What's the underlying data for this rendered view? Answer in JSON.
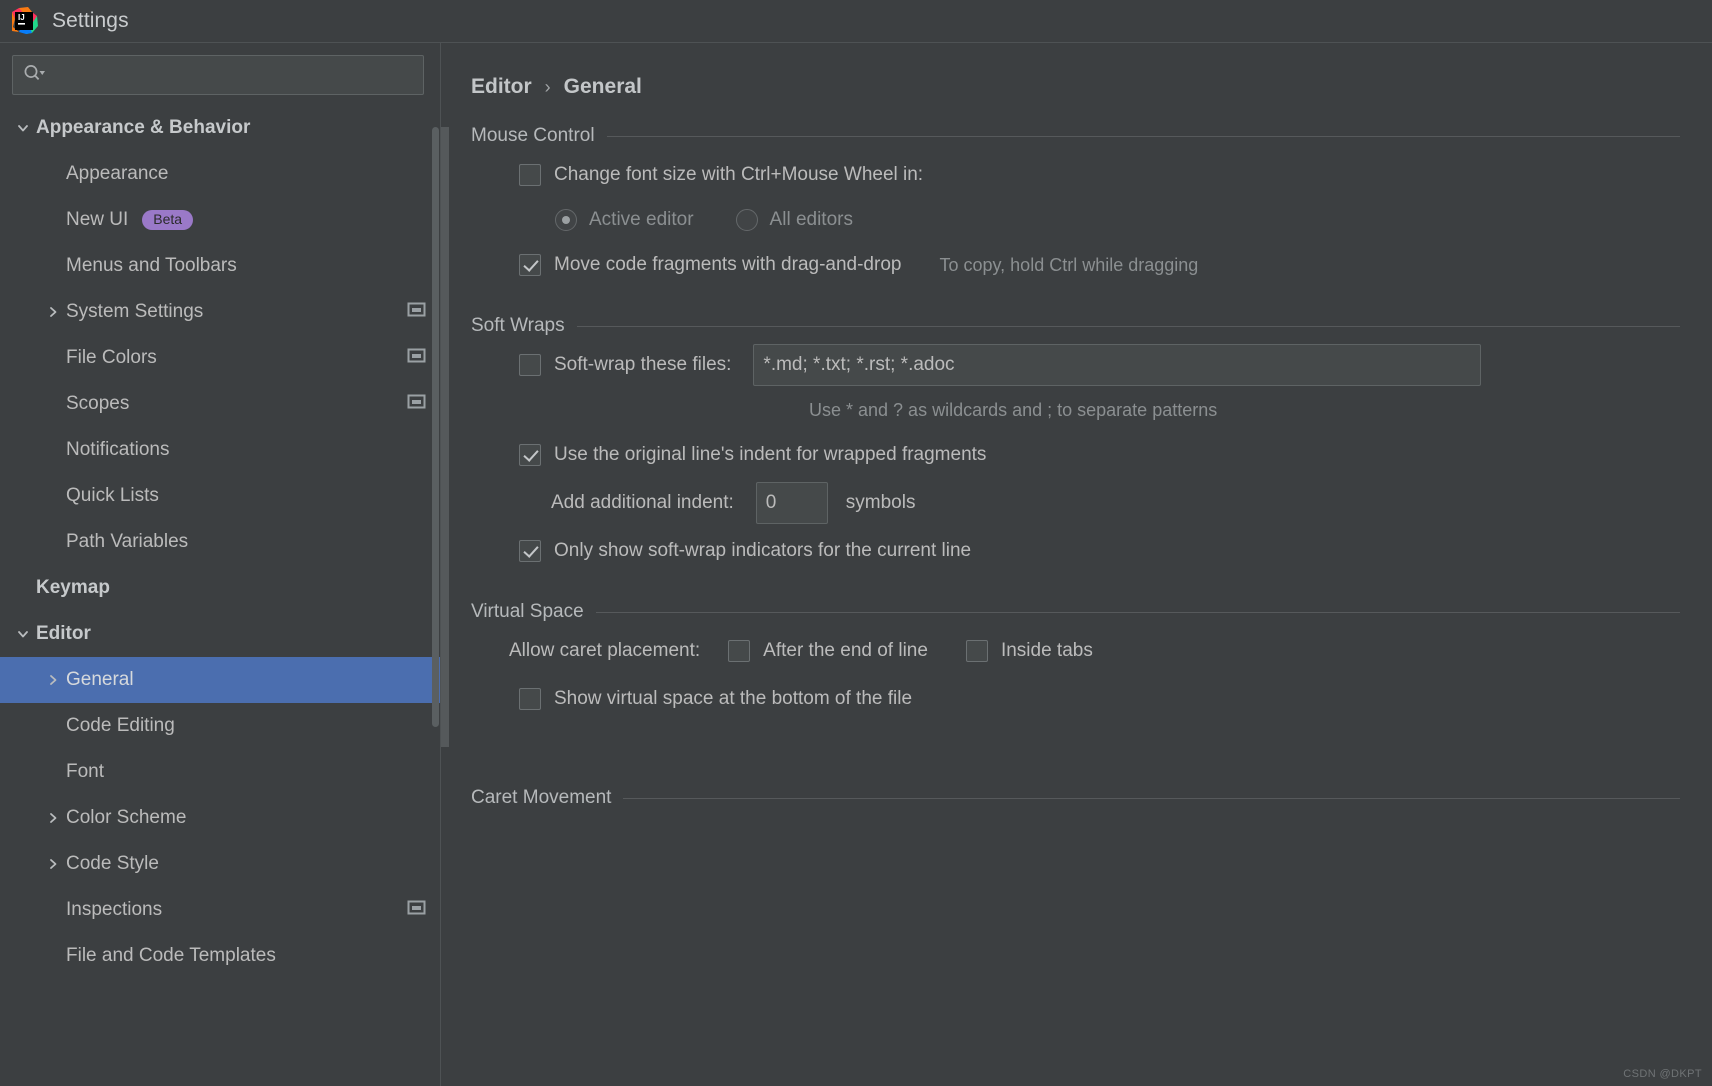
{
  "window": {
    "title": "Settings",
    "logo_icon": "intellij-idea-logo"
  },
  "search": {
    "value": "",
    "placeholder": "",
    "icon": "search-icon"
  },
  "sidebar": {
    "items": [
      {
        "label": "Appearance & Behavior",
        "level": 0,
        "bold": true,
        "twisty": "chevron-down",
        "selected": false,
        "badge": "",
        "trailing_icon": ""
      },
      {
        "label": "Appearance",
        "level": 1,
        "bold": false,
        "twisty": "",
        "selected": false,
        "badge": "",
        "trailing_icon": ""
      },
      {
        "label": "New UI",
        "level": 1,
        "bold": false,
        "twisty": "",
        "selected": false,
        "badge": "Beta",
        "trailing_icon": ""
      },
      {
        "label": "Menus and Toolbars",
        "level": 1,
        "bold": false,
        "twisty": "",
        "selected": false,
        "badge": "",
        "trailing_icon": ""
      },
      {
        "label": "System Settings",
        "level": 1,
        "bold": false,
        "twisty": "chevron-right",
        "selected": false,
        "badge": "",
        "trailing_icon": "project-scope-icon"
      },
      {
        "label": "File Colors",
        "level": 1,
        "bold": false,
        "twisty": "",
        "selected": false,
        "badge": "",
        "trailing_icon": "project-scope-icon"
      },
      {
        "label": "Scopes",
        "level": 1,
        "bold": false,
        "twisty": "",
        "selected": false,
        "badge": "",
        "trailing_icon": "project-scope-icon"
      },
      {
        "label": "Notifications",
        "level": 1,
        "bold": false,
        "twisty": "",
        "selected": false,
        "badge": "",
        "trailing_icon": ""
      },
      {
        "label": "Quick Lists",
        "level": 1,
        "bold": false,
        "twisty": "",
        "selected": false,
        "badge": "",
        "trailing_icon": ""
      },
      {
        "label": "Path Variables",
        "level": 1,
        "bold": false,
        "twisty": "",
        "selected": false,
        "badge": "",
        "trailing_icon": ""
      },
      {
        "label": "Keymap",
        "level": 0,
        "bold": true,
        "twisty": "",
        "selected": false,
        "badge": "",
        "trailing_icon": ""
      },
      {
        "label": "Editor",
        "level": 0,
        "bold": true,
        "twisty": "chevron-down",
        "selected": false,
        "badge": "",
        "trailing_icon": ""
      },
      {
        "label": "General",
        "level": 1,
        "bold": false,
        "twisty": "chevron-right",
        "selected": true,
        "badge": "",
        "trailing_icon": ""
      },
      {
        "label": "Code Editing",
        "level": 1,
        "bold": false,
        "twisty": "",
        "selected": false,
        "badge": "",
        "trailing_icon": ""
      },
      {
        "label": "Font",
        "level": 1,
        "bold": false,
        "twisty": "",
        "selected": false,
        "badge": "",
        "trailing_icon": ""
      },
      {
        "label": "Color Scheme",
        "level": 1,
        "bold": false,
        "twisty": "chevron-right",
        "selected": false,
        "badge": "",
        "trailing_icon": ""
      },
      {
        "label": "Code Style",
        "level": 1,
        "bold": false,
        "twisty": "chevron-right",
        "selected": false,
        "badge": "",
        "trailing_icon": ""
      },
      {
        "label": "Inspections",
        "level": 1,
        "bold": false,
        "twisty": "",
        "selected": false,
        "badge": "",
        "trailing_icon": "project-scope-icon"
      },
      {
        "label": "File and Code Templates",
        "level": 1,
        "bold": false,
        "twisty": "",
        "selected": false,
        "badge": "",
        "trailing_icon": ""
      }
    ]
  },
  "breadcrumb": {
    "parent": "Editor",
    "separator": "›",
    "current": "General"
  },
  "sections": {
    "mouse_control": {
      "title": "Mouse Control",
      "change_font_size": "Change font size with Ctrl+Mouse Wheel in:",
      "radio_active_editor": "Active editor",
      "radio_all_editors": "All editors",
      "move_code_fragments": "Move code fragments with drag-and-drop",
      "move_code_hint": "To copy, hold Ctrl while dragging"
    },
    "soft_wraps": {
      "title": "Soft Wraps",
      "soft_wrap_label": "Soft-wrap these files:",
      "soft_wrap_value": "*.md; *.txt; *.rst; *.adoc",
      "wildcard_hint": "Use * and ? as wildcards and ; to separate patterns",
      "use_original_indent": "Use the original line's indent for wrapped fragments",
      "add_indent_label": "Add additional indent:",
      "add_indent_value": "0",
      "symbols_label": "symbols",
      "only_show_indicators": "Only show soft-wrap indicators for the current line"
    },
    "virtual_space": {
      "title": "Virtual Space",
      "allow_caret_label": "Allow caret placement:",
      "after_end_of_line": "After the end of line",
      "inside_tabs": "Inside tabs",
      "show_virtual_space": "Show virtual space at the bottom of the file"
    },
    "caret_movement": {
      "title": "Caret Movement"
    }
  },
  "watermark": "CSDN @DKPT",
  "colors": {
    "background": "#3c3f41",
    "selection": "#4b6eaf",
    "text": "#bbbbbb",
    "dim_text": "#8b8f91",
    "badge": "#9a79c8",
    "border": "#5e6364"
  }
}
